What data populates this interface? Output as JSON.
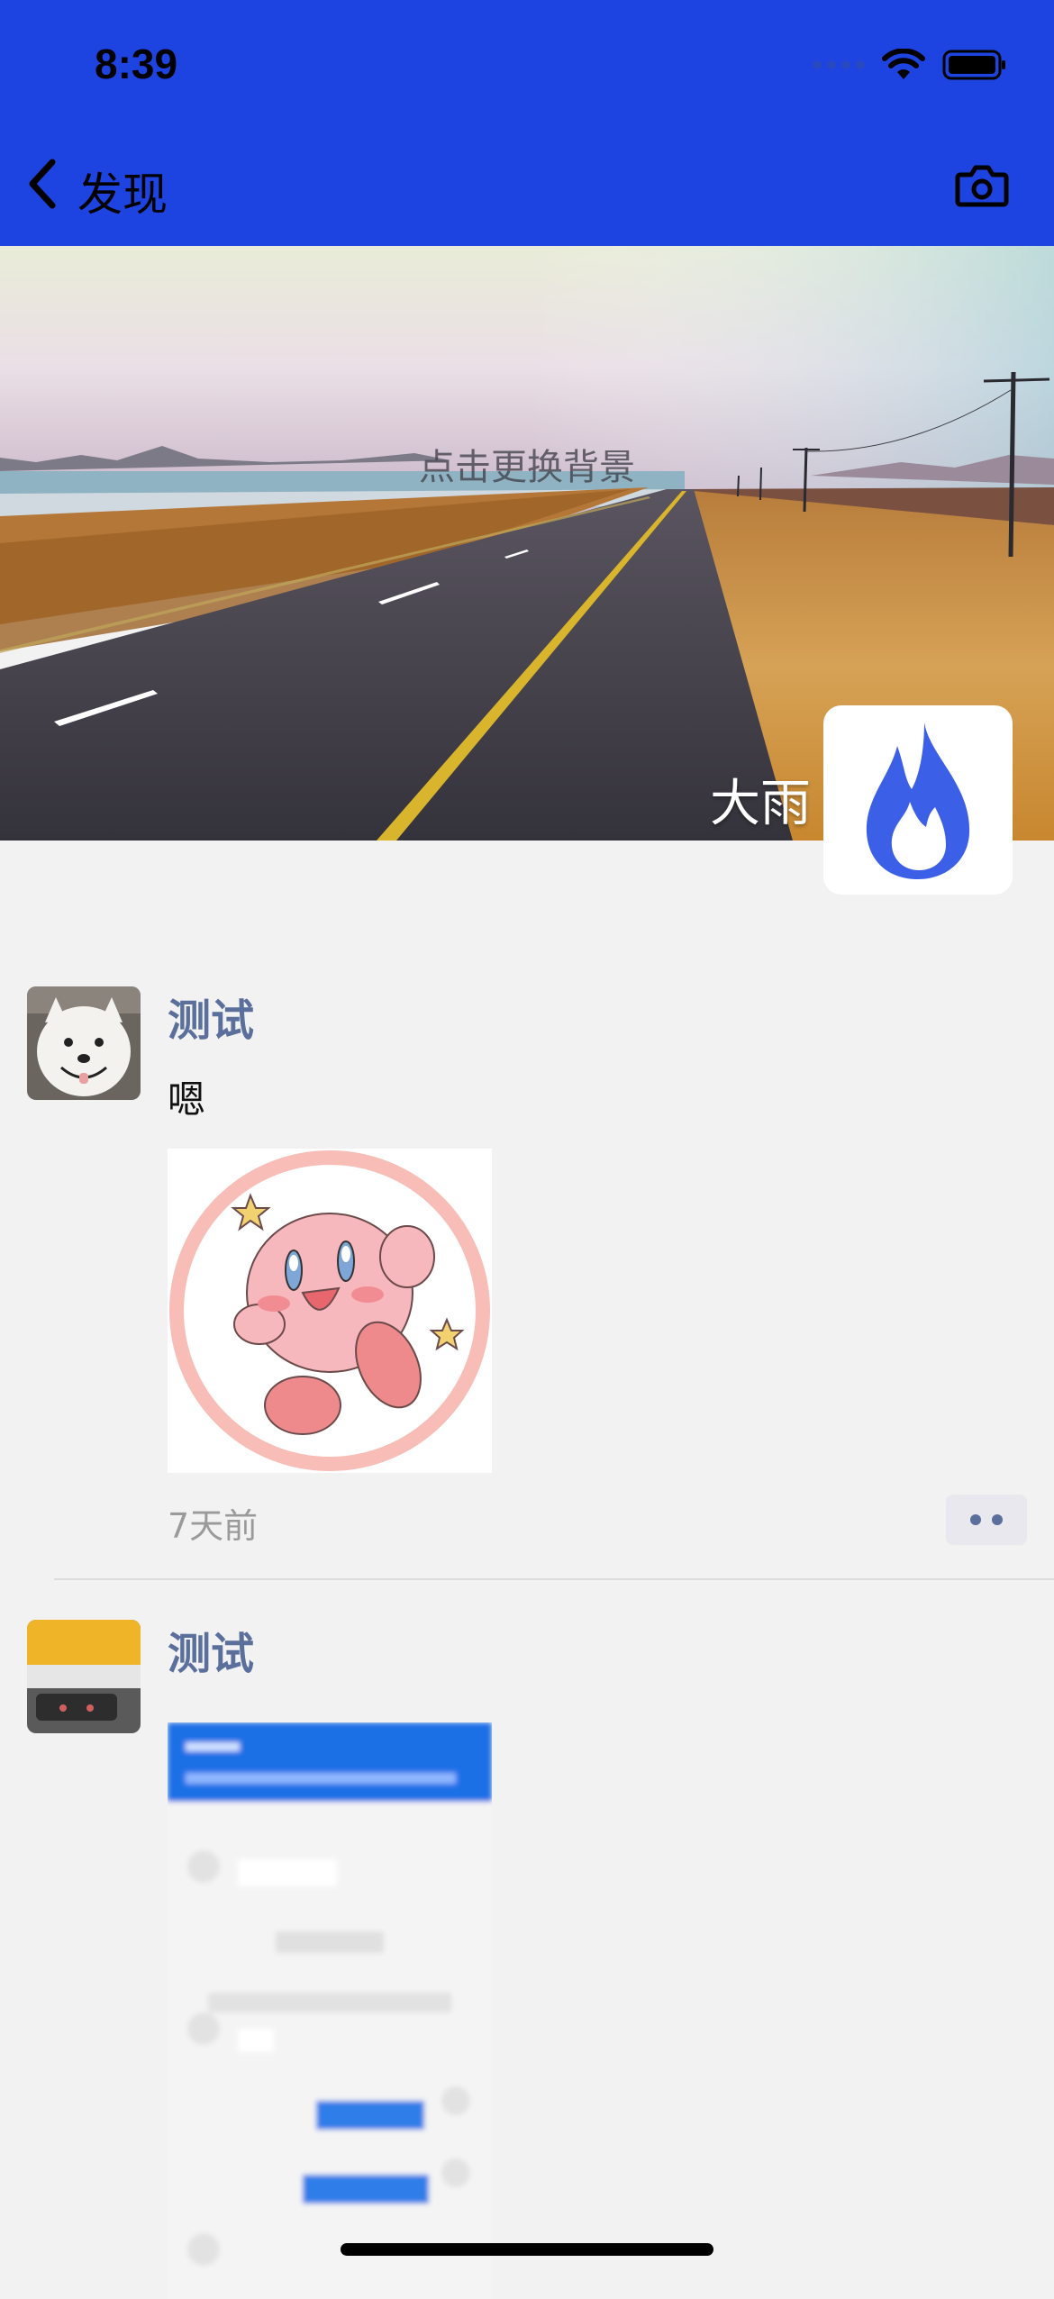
{
  "status_bar": {
    "time": "8:39"
  },
  "nav": {
    "title": "发现",
    "back_icon": "chevron-left-icon",
    "camera_icon": "camera-icon"
  },
  "banner": {
    "hint": "点击更换背景"
  },
  "profile": {
    "name": "大雨",
    "avatar_icon": "flame-icon",
    "avatar_color": "#3b5fe6"
  },
  "posts": [
    {
      "author": "测试",
      "text": "嗯",
      "time": "7天前"
    },
    {
      "author": "测试"
    }
  ],
  "colors": {
    "header": "#1d43e0",
    "author": "#5a6f9c",
    "background": "#f2f2f2"
  }
}
